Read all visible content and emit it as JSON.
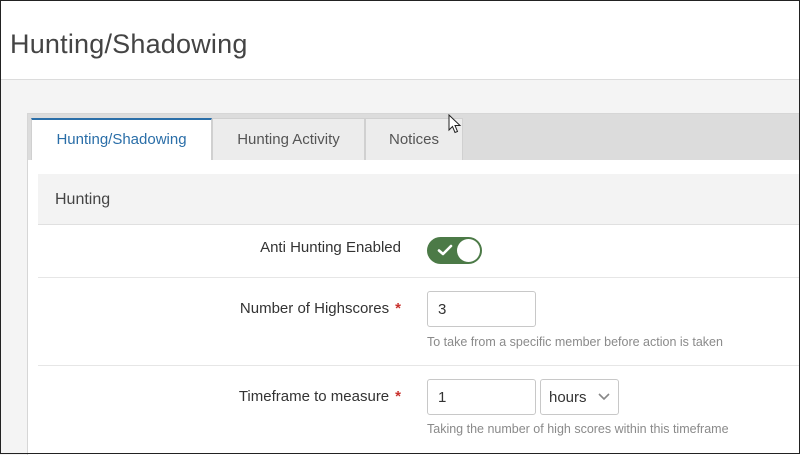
{
  "page": {
    "title": "Hunting/Shadowing"
  },
  "tabs": [
    {
      "label": "Hunting/Shadowing",
      "active": true
    },
    {
      "label": "Hunting Activity",
      "active": false
    },
    {
      "label": "Notices",
      "active": false
    }
  ],
  "section": {
    "title": "Hunting"
  },
  "fields": {
    "anti_hunting": {
      "label": "Anti Hunting Enabled",
      "enabled": true
    },
    "highscores": {
      "label": "Number of Highscores",
      "required_mark": "*",
      "value": "3",
      "help": "To take from a specific member before action is taken"
    },
    "timeframe": {
      "label": "Timeframe to measure",
      "required_mark": "*",
      "value": "1",
      "unit": "hours",
      "help": "Taking the number of high scores within this timeframe"
    }
  },
  "colors": {
    "accent": "#2a6ea8",
    "toggle_on": "#4c7a47",
    "required": "#c9302c"
  }
}
